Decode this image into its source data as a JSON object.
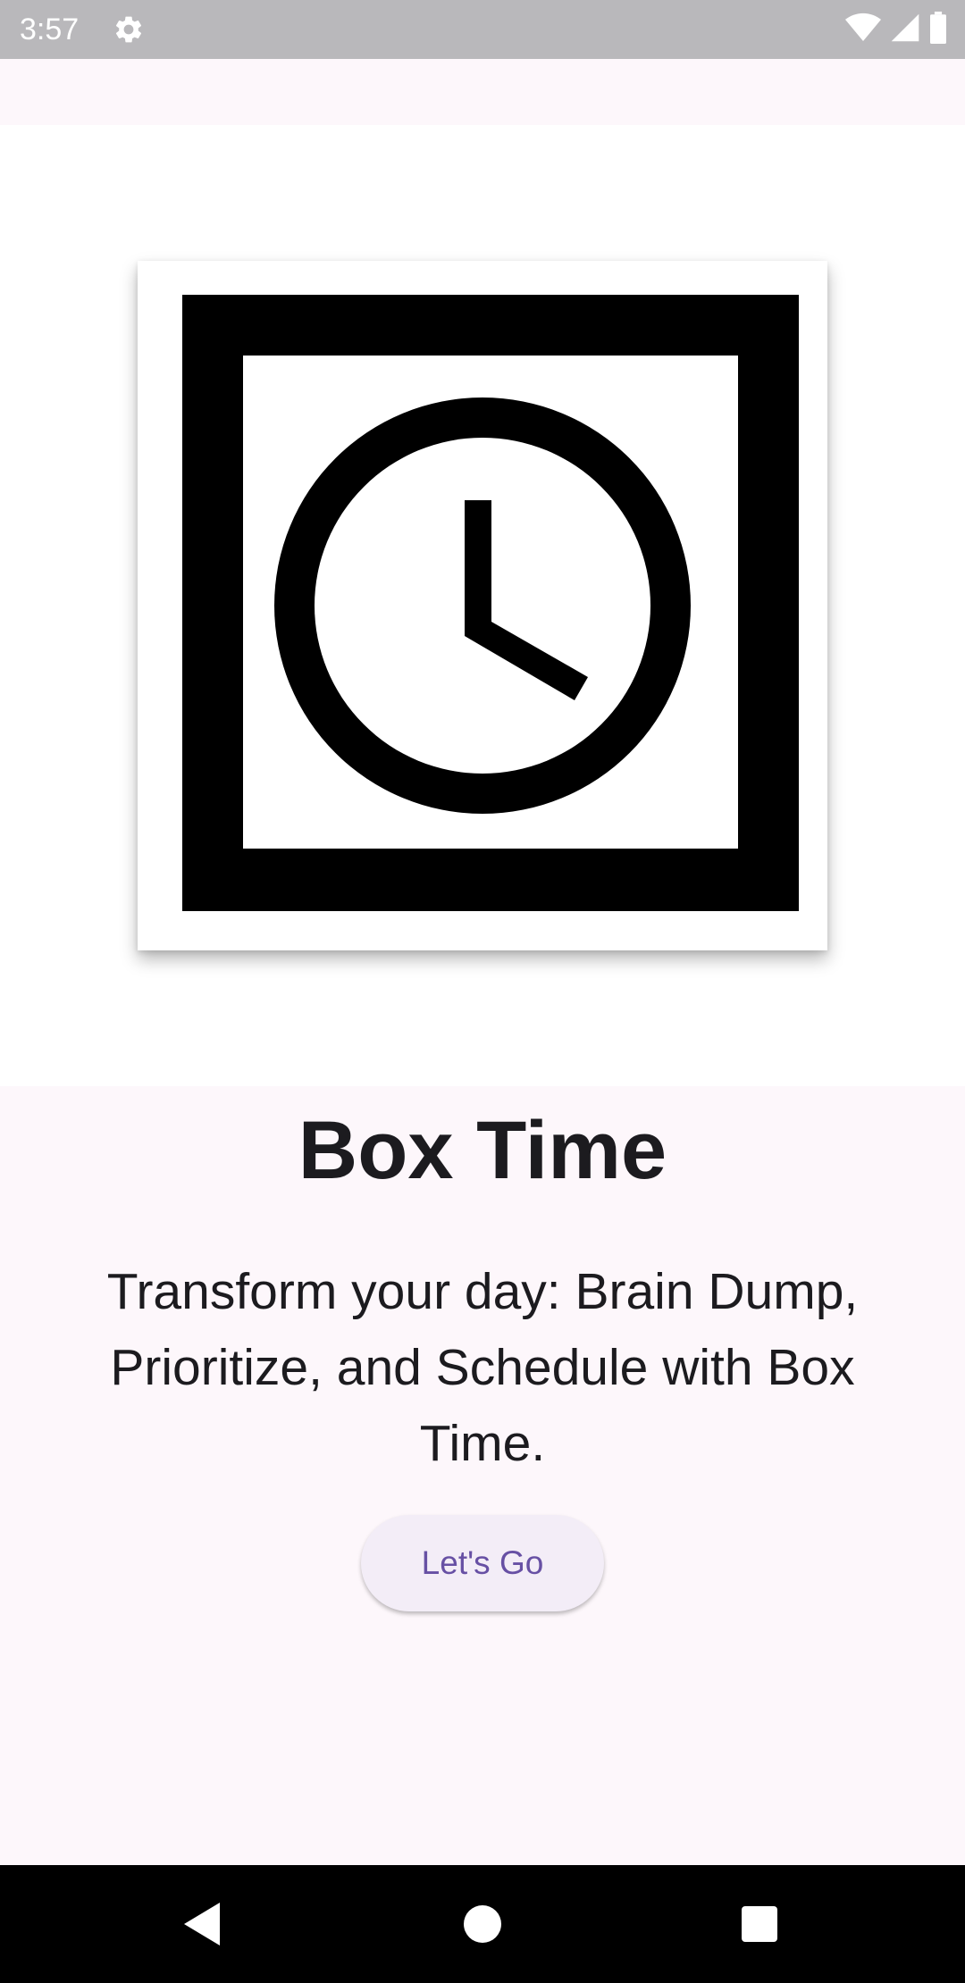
{
  "status_bar": {
    "time": "3:57",
    "icons": [
      "gear-icon",
      "wifi-icon",
      "cell-signal-icon",
      "battery-icon"
    ]
  },
  "app": {
    "logo": "box-clock-logo",
    "title": "Box Time",
    "subtitle": "Transform your day: Brain Dump, Prioritize, and Schedule with Box Time.",
    "cta_label": "Let's Go"
  },
  "nav_bar": {
    "buttons": [
      "back-icon",
      "home-icon",
      "recents-icon"
    ]
  },
  "colors": {
    "background": "#fdf7fb",
    "status_bar": "#b9b8bb",
    "button_bg": "#f3edf7",
    "button_text": "#6750a4",
    "text": "#1c1b1f"
  }
}
